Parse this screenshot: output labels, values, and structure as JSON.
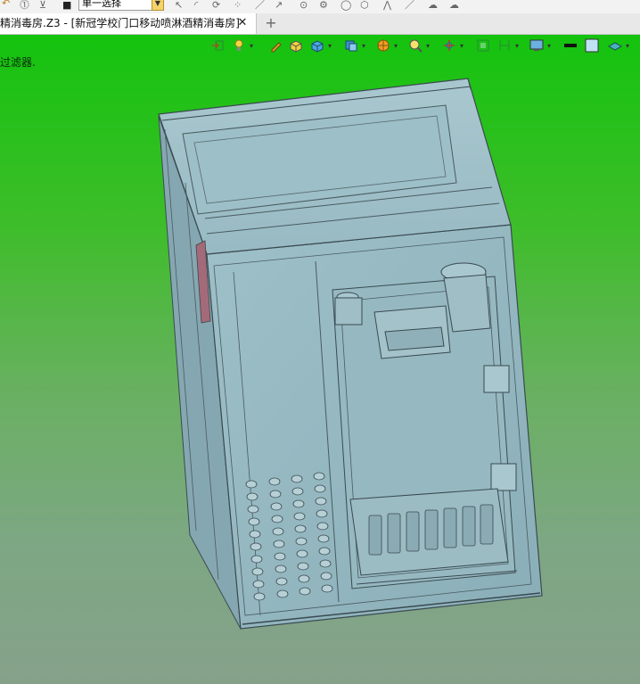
{
  "toolbar": {
    "select_value": "单一选择",
    "top_icons": [
      "select-pointer-icon",
      "filter-icon",
      "sketch-arc-icon",
      "sketch-line-icon",
      "circle-icon",
      "polygon-icon"
    ]
  },
  "tabs": [
    {
      "label": "精消毒房.Z3 - [新冠学校门口移动喷淋酒精消毒房]",
      "close": "✕",
      "active": true
    }
  ],
  "tab_add": "+",
  "viewport": {
    "hint": "过滤器.",
    "background_top": "#14c30e",
    "background_bottom": "#86a18a",
    "model_color": "#8fb3bd",
    "view_tools": [
      "import-icon",
      "light-icon",
      "pen-icon",
      "shaded-cube-icon",
      "cube-view-icon",
      "display-mode-icon",
      "sphere-render-icon",
      "zoom-icon",
      "axis-icon",
      "fit-view-icon",
      "dimension-icon",
      "monitor-icon",
      "line-color-icon",
      "fill-color-icon",
      "layer-icon"
    ]
  }
}
